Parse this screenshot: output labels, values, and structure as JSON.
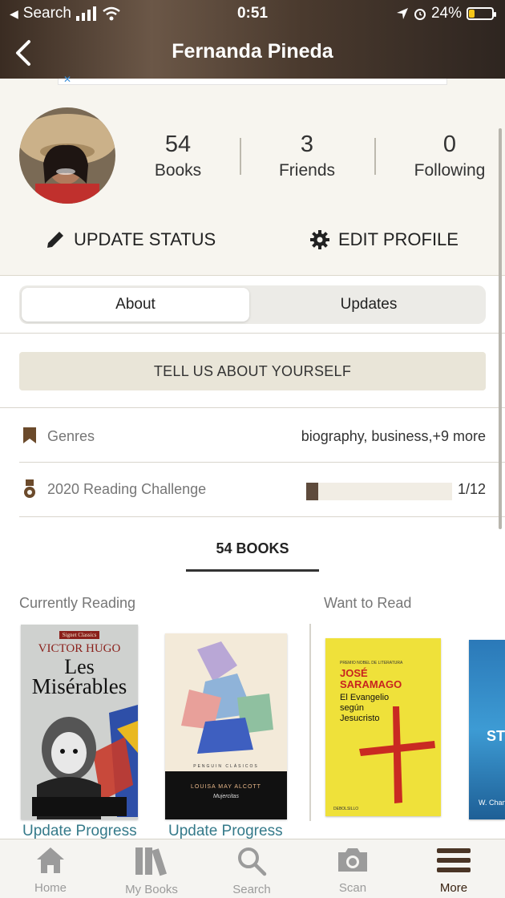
{
  "status_bar": {
    "back_app": "Search",
    "time": "0:51",
    "battery": "24%",
    "battery_level": 0.24
  },
  "nav": {
    "title": "Fernanda Pineda"
  },
  "profile": {
    "stats": [
      {
        "value": "54",
        "label": "Books"
      },
      {
        "value": "3",
        "label": "Friends"
      },
      {
        "value": "0",
        "label": "Following"
      }
    ],
    "update_status": "UPDATE STATUS",
    "edit_profile": "EDIT PROFILE"
  },
  "tabs": {
    "about": "About",
    "updates": "Updates",
    "active": "About"
  },
  "tell_us": "TELL US ABOUT YOURSELF",
  "genres": {
    "label": "Genres",
    "value": "biography, business,+9 more"
  },
  "challenge": {
    "label": "2020 Reading Challenge",
    "progress": "1/12",
    "fraction": 0.0833
  },
  "books": {
    "tab": "54 BOOKS",
    "currently_reading": "Currently Reading",
    "want_to_read": "Want to Read",
    "update_link": "Update Progress",
    "covers": {
      "miserables": {
        "series": "Signet Classics",
        "author": "VICTOR HUGO",
        "title_1": "Les",
        "title_2": "Misérables"
      },
      "mujercitas": {
        "publisher": "PENGUIN CLÁSICOS",
        "author": "LOUISA MAY ALCOTT",
        "title": "Mujercitas"
      },
      "evangelio": {
        "award": "PREMIO NOBEL DE LITERATURA",
        "author_1": "JOSÉ",
        "author_2": "SARAMAGO",
        "title_1": "El Evangelio",
        "title_2": "según",
        "title_3": "Jesucristo",
        "publisher": "DEBOLSILLO"
      },
      "partial": {
        "title": "ST",
        "author": "W. Chan"
      }
    }
  },
  "tabbar": [
    {
      "label": "Home",
      "icon": "home-icon"
    },
    {
      "label": "My Books",
      "icon": "my-books-icon"
    },
    {
      "label": "Search",
      "icon": "search-icon"
    },
    {
      "label": "Scan",
      "icon": "camera-icon"
    },
    {
      "label": "More",
      "icon": "menu-icon"
    }
  ],
  "colors": {
    "brand_dark": "#382110",
    "link": "#357a8a",
    "progress": "#5e4b3c",
    "beige": "#f7f5ef"
  }
}
